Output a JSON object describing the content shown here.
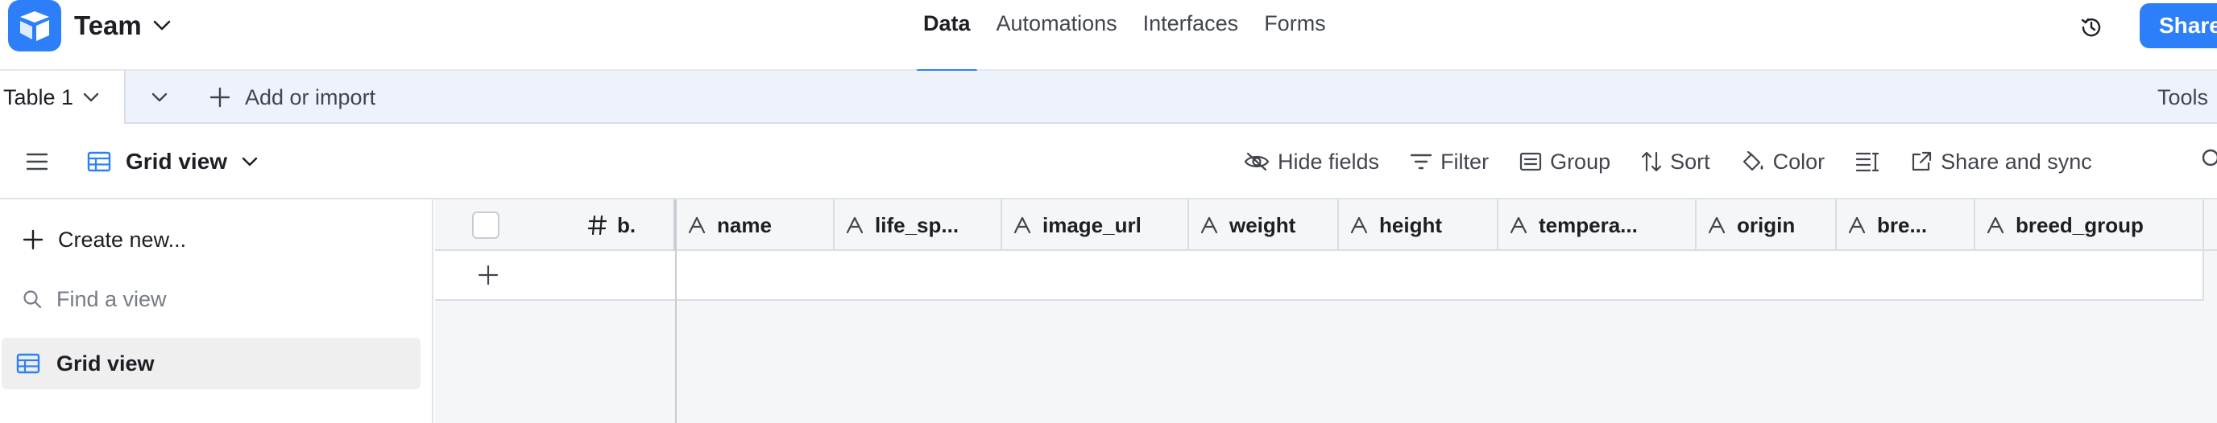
{
  "app": {
    "base_name": "Team",
    "brand_color": "#2d7ff9",
    "logo_icon": "airtable-logo-icon"
  },
  "topnav": {
    "tabs": [
      {
        "label": "Data",
        "active": true
      },
      {
        "label": "Automations",
        "active": false
      },
      {
        "label": "Interfaces",
        "active": false
      },
      {
        "label": "Forms",
        "active": false
      }
    ],
    "share_label": "Share"
  },
  "tablebar": {
    "current_table": "Table 1",
    "add_label": "Add or import",
    "tools_label": "Tools"
  },
  "viewbar": {
    "current_view": "Grid view",
    "actions": {
      "hide_fields": "Hide fields",
      "filter": "Filter",
      "group": "Group",
      "sort": "Sort",
      "color": "Color",
      "share_sync": "Share and sync"
    }
  },
  "sidebar": {
    "create_label": "Create new...",
    "search_placeholder": "Find a view",
    "views": [
      {
        "label": "Grid view",
        "selected": true
      }
    ]
  },
  "grid": {
    "primary_field": "b.",
    "columns": [
      {
        "label": "name"
      },
      {
        "label": "life_sp..."
      },
      {
        "label": "image_url"
      },
      {
        "label": "weight"
      },
      {
        "label": "height"
      },
      {
        "label": "tempera..."
      },
      {
        "label": "origin"
      },
      {
        "label": "bre..."
      },
      {
        "label": "breed_group"
      }
    ]
  }
}
